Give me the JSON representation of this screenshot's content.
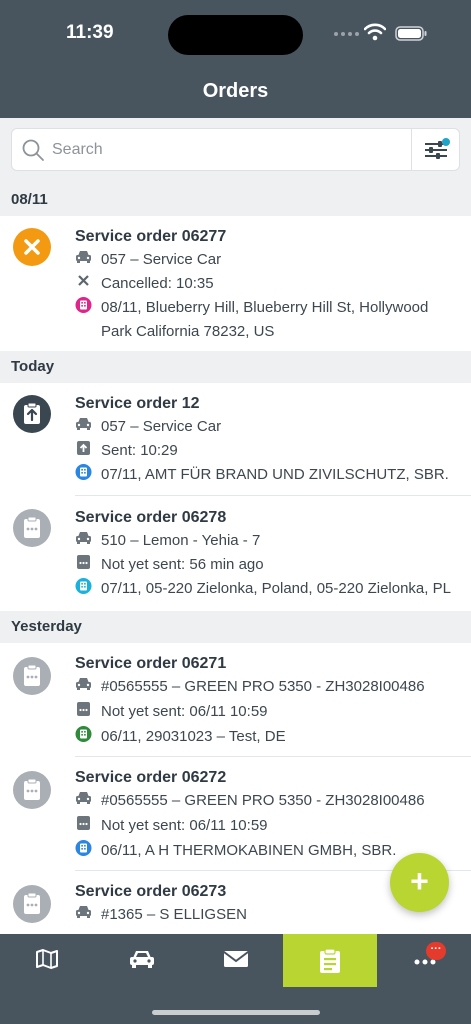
{
  "status_bar": {
    "time": "11:39"
  },
  "header": {
    "title": "Orders"
  },
  "search": {
    "placeholder": "Search"
  },
  "sections": [
    {
      "label": "08/11"
    },
    {
      "label": "Today"
    },
    {
      "label": "Yesterday"
    }
  ],
  "orders": [
    {
      "title": "Service order 06277",
      "vehicle": "057 – Service Car",
      "status": "Cancelled: 10:35",
      "address_line1": "08/11, Blueberry Hill, Blueberry Hill St, Hollywood",
      "address_line2": "Park California 78232, US",
      "icon": "cancelled-icon",
      "icon_color": "#f39a12",
      "address_icon_color": "#e0248a"
    },
    {
      "title": "Service order 12",
      "vehicle": "057 – Service Car",
      "status": "Sent: 10:29",
      "address_line1": "07/11, AMT FÜR BRAND UND ZIVILSCHUTZ, SBR.",
      "icon": "sent-icon",
      "icon_color": "#3a4650",
      "address_icon_color": "#2a86e0"
    },
    {
      "title": "Service order 06278",
      "vehicle": "510 – Lemon - Yehia - 7",
      "status": "Not yet sent: 56 min ago",
      "address_line1": "07/11, 05-220 Zielonka, Poland, 05-220 Zielonka, PL",
      "icon": "pending-icon",
      "icon_color": "#a9afb4",
      "address_icon_color": "#1ab2dd"
    },
    {
      "title": "Service order 06271",
      "vehicle": "#0565555 – GREEN PRO 5350 - ZH3028I00486",
      "status": "Not yet sent: 06/11 10:59",
      "address_line1": "06/11, 29031023 – Test, DE",
      "icon": "pending-icon",
      "icon_color": "#a9afb4",
      "address_icon_color": "#2f8a3a"
    },
    {
      "title": "Service order 06272",
      "vehicle": "#0565555 – GREEN PRO 5350 - ZH3028I00486",
      "status": "Not yet sent: 06/11 10:59",
      "address_line1": "06/11, A H THERMOKABINEN GMBH, SBR.",
      "icon": "pending-icon",
      "icon_color": "#a9afb4",
      "address_icon_color": "#2a86e0"
    },
    {
      "title": "Service order 06273",
      "vehicle": "#1365 – S ELLIGSEN",
      "icon": "pending-icon",
      "icon_color": "#a9afb4"
    }
  ],
  "tabs": [
    {
      "name": "map-icon",
      "active": false
    },
    {
      "name": "car-icon",
      "active": false
    },
    {
      "name": "mail-icon",
      "active": false
    },
    {
      "name": "orders-clipboard-icon",
      "active": true
    },
    {
      "name": "more-icon",
      "active": false
    }
  ],
  "more_badge": "···",
  "fab_label": "+",
  "colors": {
    "header_bg": "#48555f",
    "accent": "#b8d531",
    "section_bg": "#eef0f1"
  }
}
